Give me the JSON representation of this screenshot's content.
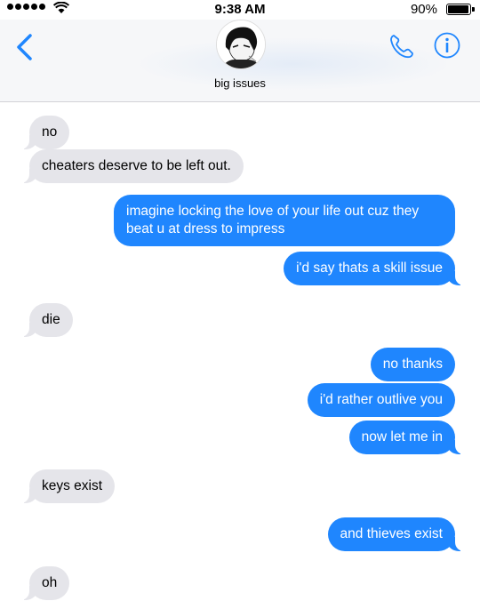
{
  "status_bar": {
    "time": "9:38 AM",
    "battery_percent": "90%",
    "battery_level": 0.9,
    "signal_icon": "signal-dots-icon",
    "wifi_icon": "wifi-icon"
  },
  "header": {
    "back_icon": "chevron-left-icon",
    "contact_name": "big issues",
    "avatar_icon": "contact-avatar",
    "call_icon": "phone-icon",
    "info_icon": "info-icon",
    "accent_color": "#1f86fe"
  },
  "messages": [
    {
      "side": "incoming",
      "text": "no"
    },
    {
      "side": "incoming",
      "text": "cheaters deserve to be left out."
    },
    {
      "side": "outgoing",
      "text": "imagine locking the love of your life out cuz they beat u at dress to impress"
    },
    {
      "side": "outgoing",
      "text": "i'd say thats a skill issue"
    },
    {
      "side": "incoming",
      "text": "die"
    },
    {
      "side": "outgoing",
      "text": "no thanks"
    },
    {
      "side": "outgoing",
      "text": "i'd rather outlive you"
    },
    {
      "side": "outgoing",
      "text": "now let me in"
    },
    {
      "side": "incoming",
      "text": "keys exist"
    },
    {
      "side": "outgoing",
      "text": "and thieves exist"
    },
    {
      "side": "incoming",
      "text": "oh"
    }
  ],
  "colors": {
    "incoming_bubble": "#e5e5ea",
    "outgoing_bubble": "#1f86fe",
    "navbar_bg": "#f6f7f9"
  }
}
